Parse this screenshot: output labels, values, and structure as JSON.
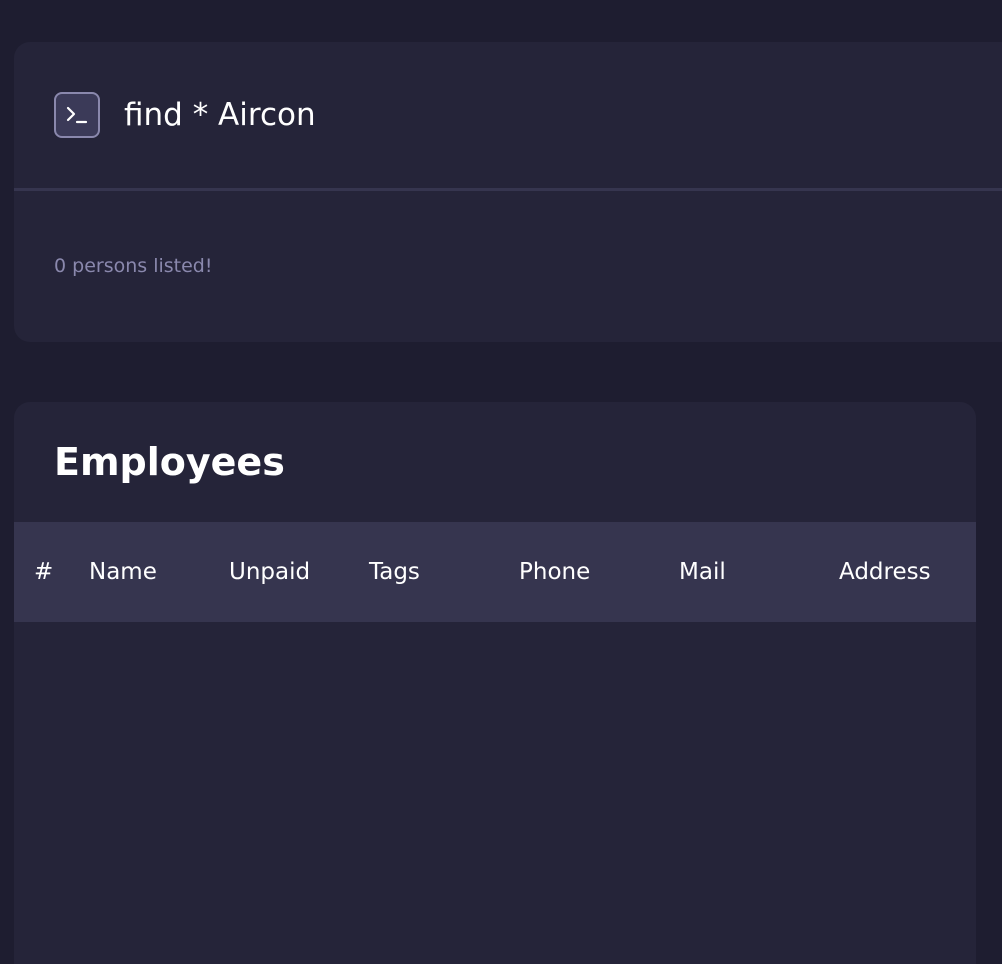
{
  "command": {
    "icon": "terminal-icon",
    "text": "find * Aircon"
  },
  "result": {
    "message": "0 persons listed!"
  },
  "employees": {
    "title": "Employees",
    "columns": [
      "#",
      "Name",
      "Unpaid",
      "Tags",
      "Phone",
      "Mail",
      "Address"
    ],
    "rows": []
  },
  "colors": {
    "background": "#1e1d30",
    "panel": "#252439",
    "header_row": "#36354f",
    "muted_text": "#8a88ad",
    "text": "#ffffff"
  }
}
